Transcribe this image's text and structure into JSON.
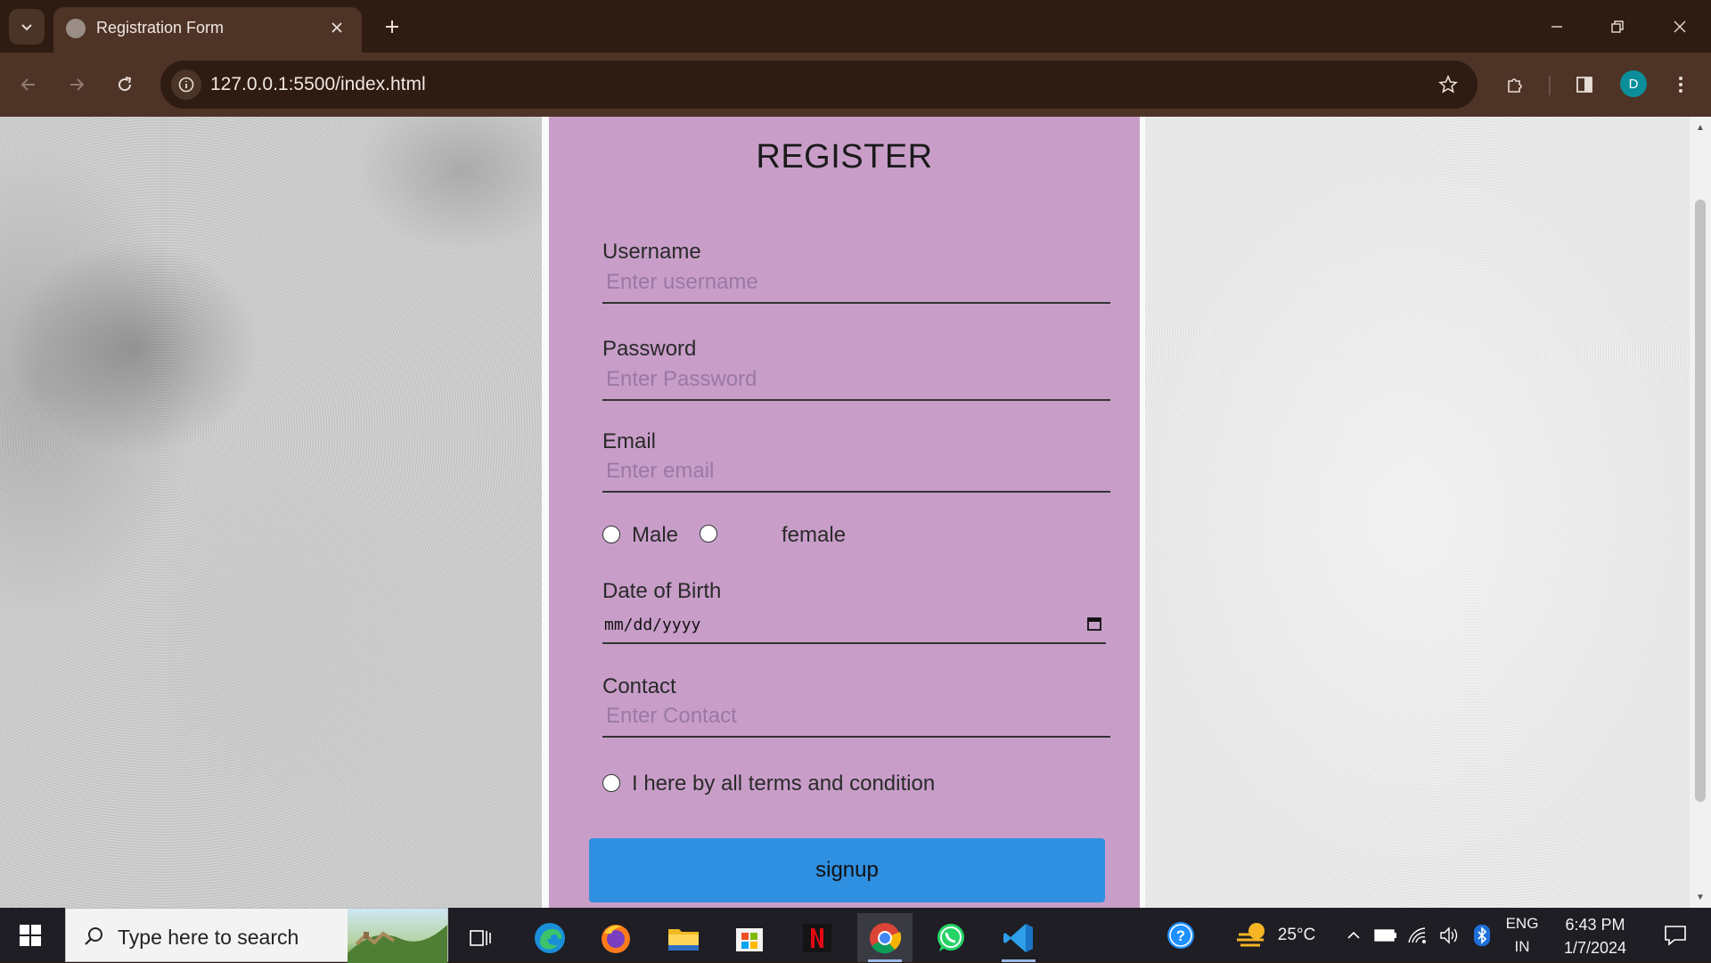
{
  "browser": {
    "tab_title": "Registration Form",
    "url": "127.0.0.1:5500/index.html",
    "profile_initial": "D"
  },
  "form": {
    "title": "REGISTER",
    "username_label": "Username",
    "username_placeholder": "Enter username",
    "password_label": "Password",
    "password_placeholder": "Enter Password",
    "email_label": "Email",
    "email_placeholder": "Enter email",
    "gender_options": [
      "Male",
      "female"
    ],
    "dob_label": "Date of Birth",
    "dob_placeholder": "mm/dd/yyyy",
    "contact_label": "Contact",
    "contact_placeholder": "Enter Contact",
    "terms_text": "I here by all terms and condition",
    "signup_label": "signup"
  },
  "taskbar": {
    "search_placeholder": "Type here to search",
    "weather_temp": "25°C",
    "language_line1": "ENG",
    "language_line2": "IN",
    "time": "6:43 PM",
    "date": "1/7/2024"
  },
  "colors": {
    "form_background": "#c89ec9",
    "signup_button": "#2f8fe0",
    "browser_frame": "#4e3327",
    "taskbar": "#1e1e24"
  }
}
